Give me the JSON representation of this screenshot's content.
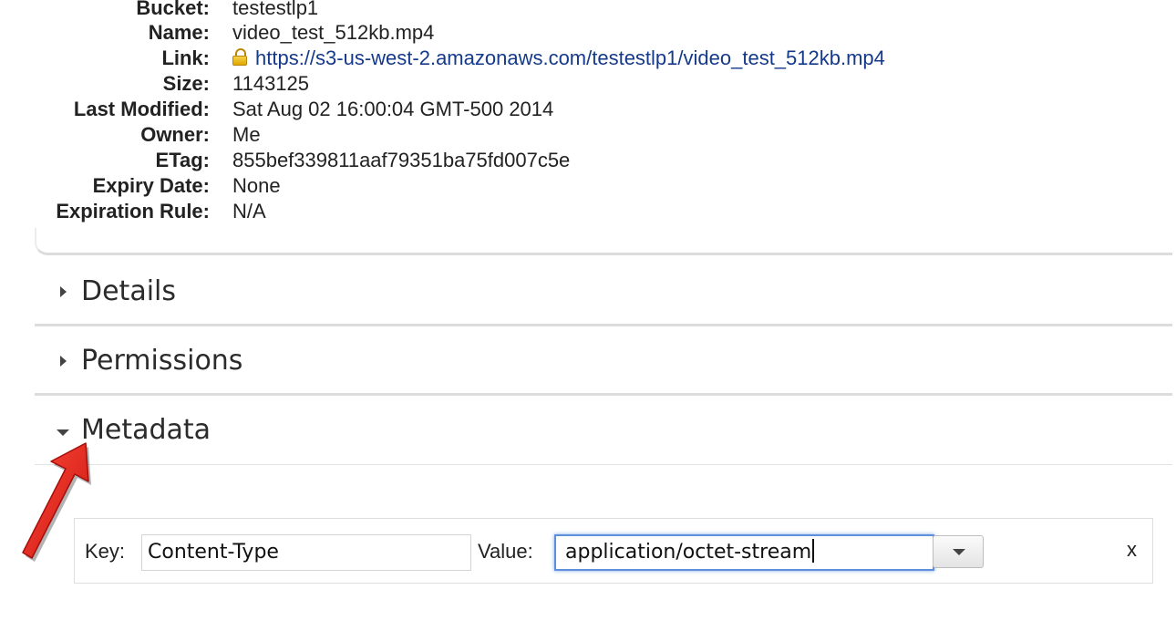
{
  "properties": [
    {
      "label": "Bucket:",
      "value": "testestlp1"
    },
    {
      "label": "Name:",
      "value": "video_test_512kb.mp4"
    },
    {
      "label": "Link:",
      "value": "https://s3-us-west-2.amazonaws.com/testestlp1/video_test_512kb.mp4"
    },
    {
      "label": "Size:",
      "value": "1143125"
    },
    {
      "label": "Last Modified:",
      "value": "Sat Aug 02 16:00:04 GMT-500 2014"
    },
    {
      "label": "Owner:",
      "value": "Me"
    },
    {
      "label": "ETag:",
      "value": "855bef339811aaf79351ba75fd007c5e"
    },
    {
      "label": "Expiry Date:",
      "value": "None"
    },
    {
      "label": "Expiration Rule:",
      "value": "N/A"
    }
  ],
  "sections": {
    "details": "Details",
    "permissions": "Permissions",
    "metadata": "Metadata"
  },
  "metadata_row": {
    "key_label": "Key:",
    "key_value": "Content-Type",
    "value_label": "Value:",
    "value_value": "application/octet-stream",
    "remove_label": "x"
  },
  "colors": {
    "link": "#153a8a",
    "annotation_arrow": "#e0201e",
    "focus_border": "#5d8fdb"
  }
}
